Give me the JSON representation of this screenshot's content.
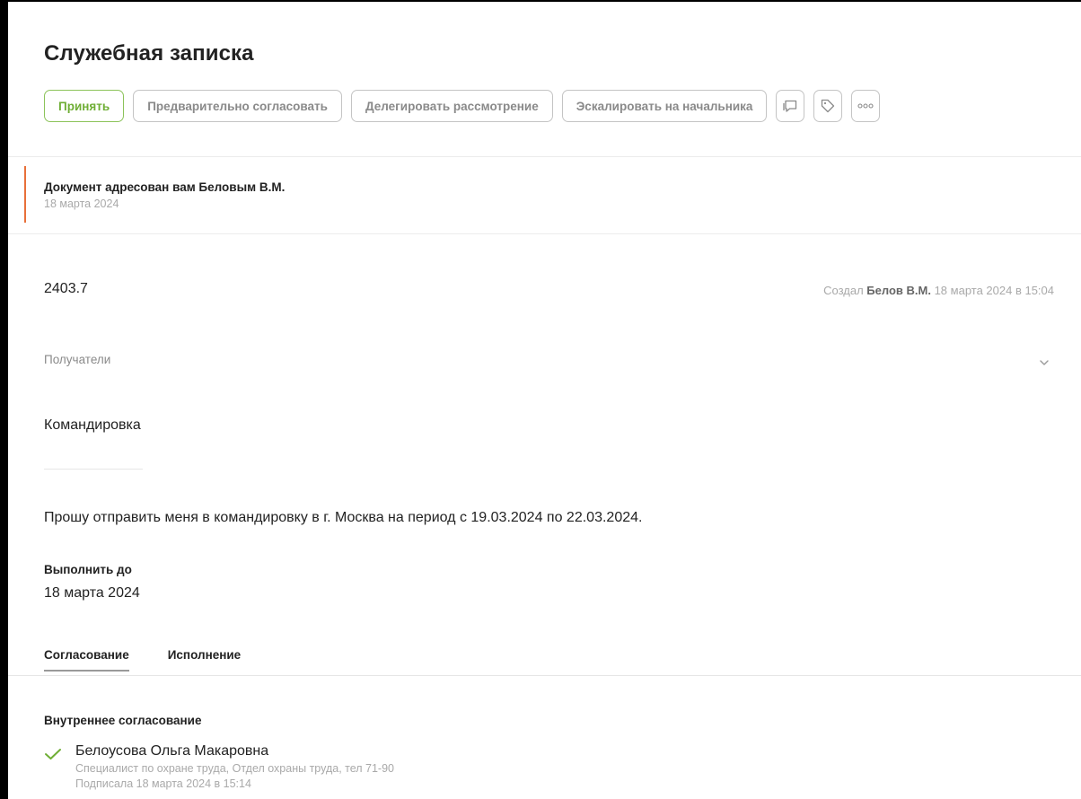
{
  "header": {
    "title": "Служебная записка"
  },
  "toolbar": {
    "accept_label": "Принять",
    "preapprove_label": "Предварительно согласовать",
    "delegate_label": "Делегировать рассмотрение",
    "escalate_label": "Эскалировать на начальника",
    "icons": [
      "comment-icon",
      "tag-icon",
      "more-icon"
    ]
  },
  "notice": {
    "title": "Документ адресован вам Беловым В.М.",
    "date": "18 марта 2024",
    "accent_color": "#e8703a"
  },
  "document": {
    "number": "2403.7",
    "created_prefix": "Создал",
    "created_by": "Белов В.М.",
    "created_at": "18 марта 2024 в 15:04",
    "recipients_label": "Получатели",
    "subject": "Командировка",
    "body": "Прошу отправить меня в командировку в г. Москва на период с 19.03.2024 по 22.03.2024.",
    "due_label": "Выполнить до",
    "due_value": "18 марта 2024"
  },
  "tabs": [
    {
      "label": "Согласование",
      "active": true
    },
    {
      "label": "Исполнение",
      "active": false
    }
  ],
  "approval": {
    "section_title": "Внутреннее согласование",
    "items": [
      {
        "name": "Белоусова Ольга Макаровна",
        "role": "Специалист по охране труда, Отдел охраны труда, тел 71-90",
        "status": "Подписала 18 марта 2024 в 15:14",
        "status_icon": "check-icon",
        "status_color": "#6fae35"
      }
    ]
  },
  "colors": {
    "primary_green": "#6fae35",
    "muted_text": "#a9a9a9",
    "border": "#c4c4c4"
  }
}
